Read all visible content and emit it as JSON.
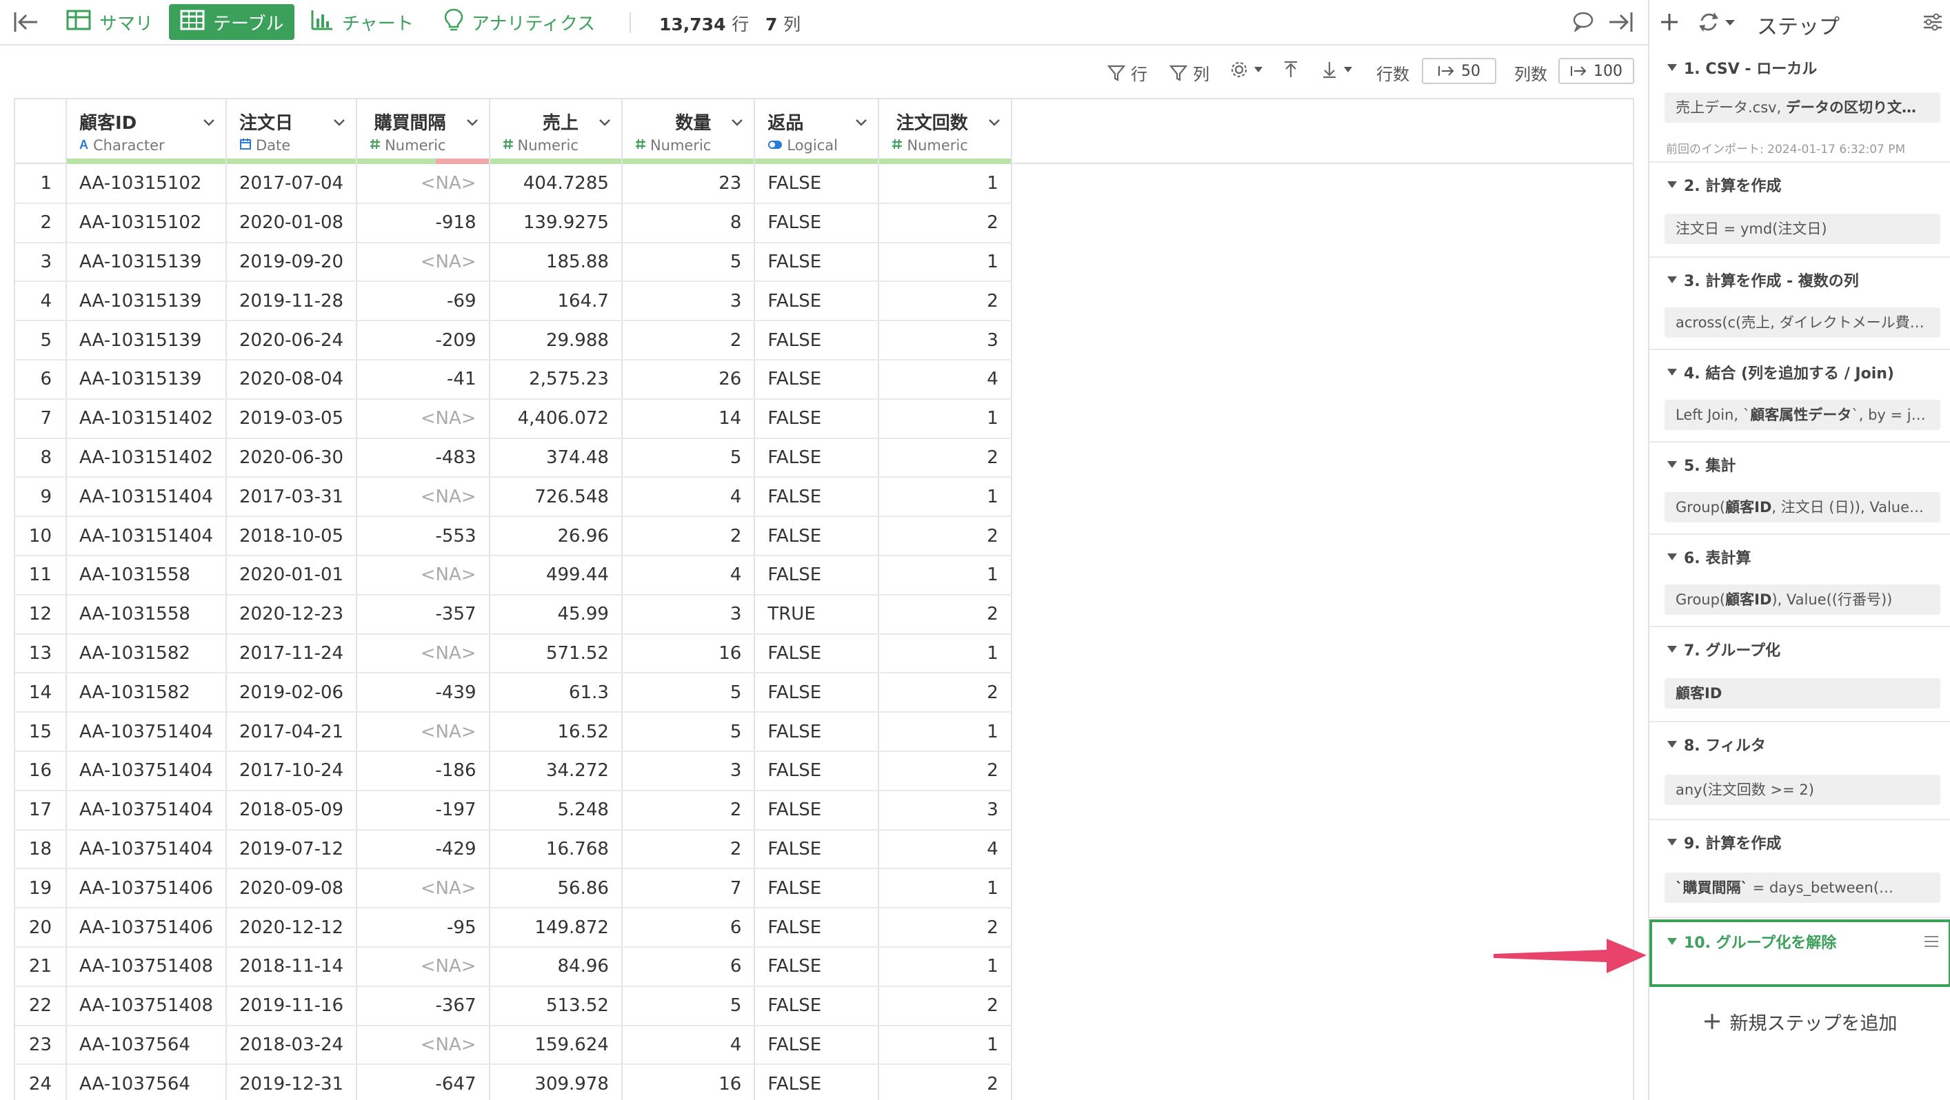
{
  "toolbar": {
    "tabs": [
      {
        "label": "サマリ",
        "icon": "summary-grid-icon"
      },
      {
        "label": "テーブル",
        "icon": "table-icon",
        "active": true
      },
      {
        "label": "チャート",
        "icon": "bar-chart-icon"
      },
      {
        "label": "アナリティクス",
        "icon": "lightbulb-icon"
      }
    ],
    "row_count": "13,734",
    "row_unit": "行",
    "col_count": "7",
    "col_unit": "列",
    "accent_color": "#3aa05a"
  },
  "subbar": {
    "filter_rows": "行",
    "filter_cols": "列",
    "rows_label": "行数",
    "rows_value": "50",
    "cols_label": "列数",
    "cols_value": "100"
  },
  "columns": [
    {
      "name": "顧客ID",
      "type": "Character",
      "type_icon": "character-icon"
    },
    {
      "name": "注文日",
      "type": "Date",
      "type_icon": "calendar-icon"
    },
    {
      "name": "購買間隔",
      "type": "Numeric",
      "type_icon": "hash-icon",
      "na_fraction": 0.4
    },
    {
      "name": "売上",
      "type": "Numeric",
      "type_icon": "hash-icon"
    },
    {
      "name": "数量",
      "type": "Numeric",
      "type_icon": "hash-icon"
    },
    {
      "name": "返品",
      "type": "Logical",
      "type_icon": "toggle-icon"
    },
    {
      "name": "注文回数",
      "type": "Numeric",
      "type_icon": "hash-icon"
    }
  ],
  "rows": [
    [
      "1",
      "AA-10315102",
      "2017-07-04",
      "<NA>",
      "404.7285",
      "23",
      "FALSE",
      "1"
    ],
    [
      "2",
      "AA-10315102",
      "2020-01-08",
      "-918",
      "139.9275",
      "8",
      "FALSE",
      "2"
    ],
    [
      "3",
      "AA-10315139",
      "2019-09-20",
      "<NA>",
      "185.88",
      "5",
      "FALSE",
      "1"
    ],
    [
      "4",
      "AA-10315139",
      "2019-11-28",
      "-69",
      "164.7",
      "3",
      "FALSE",
      "2"
    ],
    [
      "5",
      "AA-10315139",
      "2020-06-24",
      "-209",
      "29.988",
      "2",
      "FALSE",
      "3"
    ],
    [
      "6",
      "AA-10315139",
      "2020-08-04",
      "-41",
      "2,575.23",
      "26",
      "FALSE",
      "4"
    ],
    [
      "7",
      "AA-103151402",
      "2019-03-05",
      "<NA>",
      "4,406.072",
      "14",
      "FALSE",
      "1"
    ],
    [
      "8",
      "AA-103151402",
      "2020-06-30",
      "-483",
      "374.48",
      "5",
      "FALSE",
      "2"
    ],
    [
      "9",
      "AA-103151404",
      "2017-03-31",
      "<NA>",
      "726.548",
      "4",
      "FALSE",
      "1"
    ],
    [
      "10",
      "AA-103151404",
      "2018-10-05",
      "-553",
      "26.96",
      "2",
      "FALSE",
      "2"
    ],
    [
      "11",
      "AA-1031558",
      "2020-01-01",
      "<NA>",
      "499.44",
      "4",
      "FALSE",
      "1"
    ],
    [
      "12",
      "AA-1031558",
      "2020-12-23",
      "-357",
      "45.99",
      "3",
      "TRUE",
      "2"
    ],
    [
      "13",
      "AA-1031582",
      "2017-11-24",
      "<NA>",
      "571.52",
      "16",
      "FALSE",
      "1"
    ],
    [
      "14",
      "AA-1031582",
      "2019-02-06",
      "-439",
      "61.3",
      "5",
      "FALSE",
      "2"
    ],
    [
      "15",
      "AA-103751404",
      "2017-04-21",
      "<NA>",
      "16.52",
      "5",
      "FALSE",
      "1"
    ],
    [
      "16",
      "AA-103751404",
      "2017-10-24",
      "-186",
      "34.272",
      "3",
      "FALSE",
      "2"
    ],
    [
      "17",
      "AA-103751404",
      "2018-05-09",
      "-197",
      "5.248",
      "2",
      "FALSE",
      "3"
    ],
    [
      "18",
      "AA-103751404",
      "2019-07-12",
      "-429",
      "16.768",
      "2",
      "FALSE",
      "4"
    ],
    [
      "19",
      "AA-103751406",
      "2020-09-08",
      "<NA>",
      "56.86",
      "7",
      "FALSE",
      "1"
    ],
    [
      "20",
      "AA-103751406",
      "2020-12-12",
      "-95",
      "149.872",
      "6",
      "FALSE",
      "2"
    ],
    [
      "21",
      "AA-103751408",
      "2018-11-14",
      "<NA>",
      "84.96",
      "6",
      "FALSE",
      "1"
    ],
    [
      "22",
      "AA-103751408",
      "2019-11-16",
      "-367",
      "513.52",
      "5",
      "FALSE",
      "2"
    ],
    [
      "23",
      "AA-1037564",
      "2018-03-24",
      "<NA>",
      "159.624",
      "4",
      "FALSE",
      "1"
    ],
    [
      "24",
      "AA-1037564",
      "2019-12-31",
      "-647",
      "309.978",
      "16",
      "FALSE",
      "2"
    ]
  ],
  "panel": {
    "title": "ステップ",
    "steps": [
      {
        "title": "1. CSV - ローカル",
        "detail_plain": "売上データ.csv, ",
        "detail_bold": "データの区切り文…",
        "note": "前回のインポート: 2024-01-17 6:32:07 PM"
      },
      {
        "title": "2. 計算を作成",
        "detail_plain": "注文日 = ymd(注文日)"
      },
      {
        "title": "3. 計算を作成 - 複数の列",
        "detail_plain": "across(c(売上, ダイレクトメール費…"
      },
      {
        "title": "4. 結合 (列を追加する / Join)",
        "detail_plain": "Left Join, `",
        "detail_bold": "顧客属性データ",
        "detail_plain2": "`, by = joi…"
      },
      {
        "title": "5. 集計",
        "detail_plain": "Group(",
        "detail_bold": "顧客ID",
        "detail_plain2": ", 注文日 (日)), Value(売…"
      },
      {
        "title": "6. 表計算",
        "detail_plain": "Group(",
        "detail_bold": "顧客ID",
        "detail_plain2": "), Value((行番号))"
      },
      {
        "title": "7. グループ化",
        "detail_bold": "顧客ID"
      },
      {
        "title": "8. フィルタ",
        "detail_plain": "any(注文回数 >= 2)"
      },
      {
        "title": "9. 計算を作成",
        "detail_bold": "`購買間隔`",
        "detail_plain2": " = days_between(…"
      },
      {
        "title": "10. グループ化を解除"
      }
    ],
    "add_step_label": "新規ステップを追加",
    "highlight_color": "#3aa05a",
    "annotation_arrow_color": "#e8436a"
  }
}
